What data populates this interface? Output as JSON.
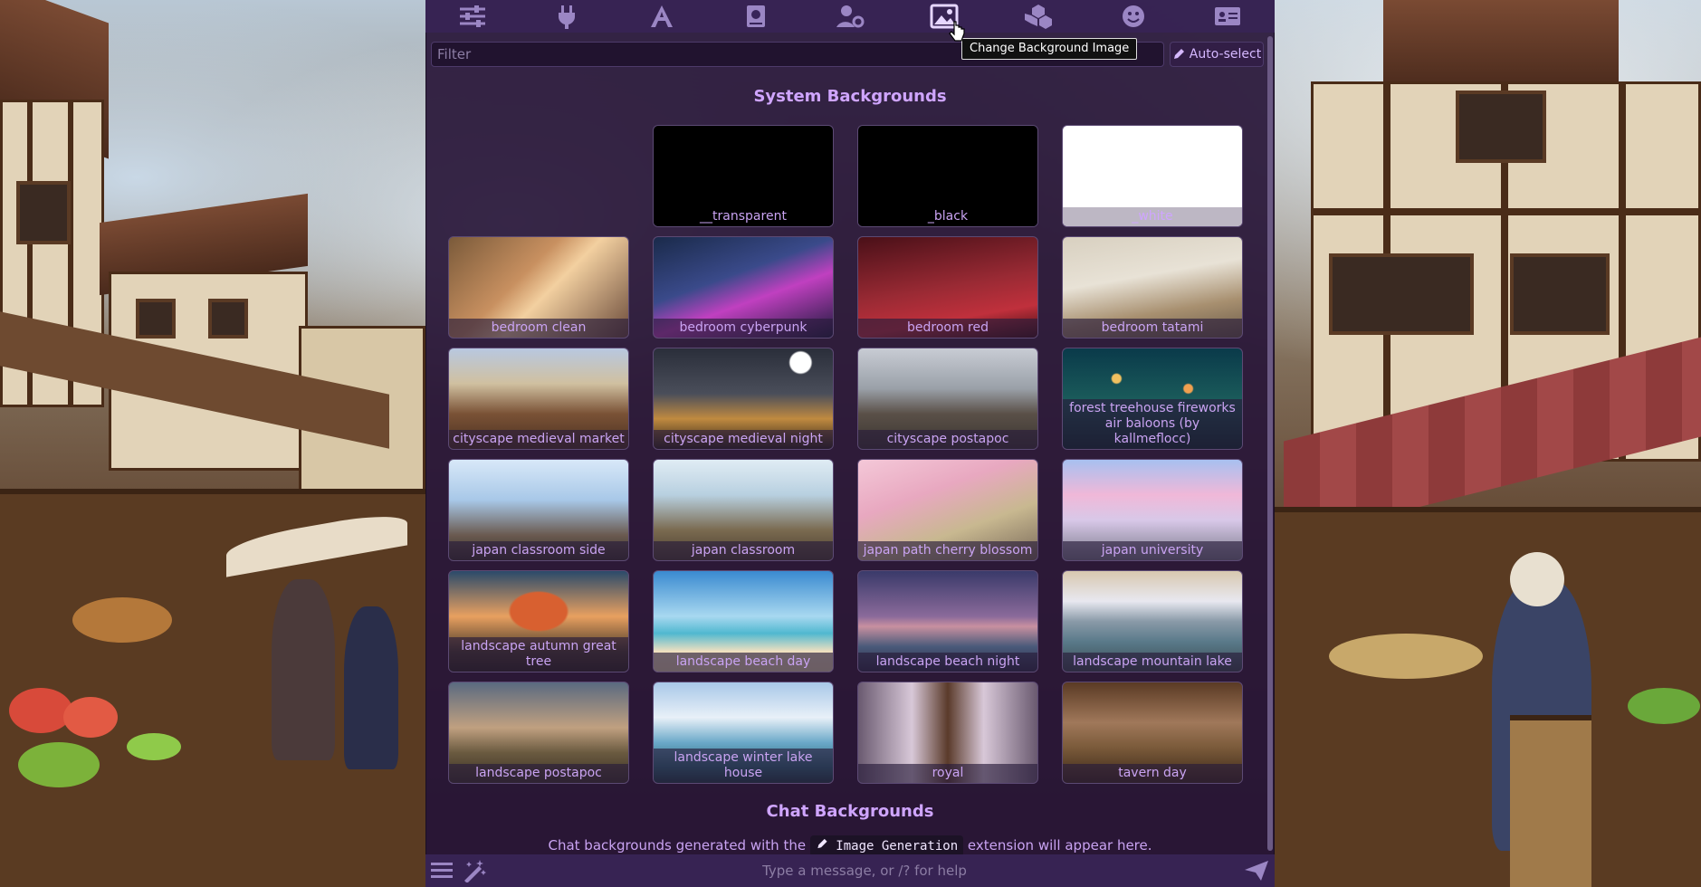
{
  "topbar": {
    "icons": [
      "sliders-icon",
      "plug-icon",
      "font-icon",
      "book-icon",
      "user-gear-icon",
      "image-icon",
      "cubes-icon",
      "smile-icon",
      "id-card-icon"
    ],
    "active_index": 5
  },
  "tooltip": "Change Background Image",
  "filter": {
    "placeholder": "Filter"
  },
  "autoselect_label": "Auto-select",
  "system_heading": "System Backgrounds",
  "backgrounds": [
    {
      "label": "__transparent"
    },
    {
      "label": "_black"
    },
    {
      "label": "_white"
    },
    {
      "label": "bedroom clean"
    },
    {
      "label": "bedroom cyberpunk"
    },
    {
      "label": "bedroom red"
    },
    {
      "label": "bedroom tatami"
    },
    {
      "label": "cityscape medieval market"
    },
    {
      "label": "cityscape medieval night"
    },
    {
      "label": "cityscape postapoc"
    },
    {
      "label": "forest treehouse fireworks air baloons (by kallmeflocc)"
    },
    {
      "label": "japan classroom side"
    },
    {
      "label": "japan classroom"
    },
    {
      "label": "japan path cherry blossom"
    },
    {
      "label": "japan university"
    },
    {
      "label": "landscape autumn great tree"
    },
    {
      "label": "landscape beach day"
    },
    {
      "label": "landscape beach night"
    },
    {
      "label": "landscape mountain lake"
    },
    {
      "label": "landscape postapoc"
    },
    {
      "label": "landscape winter lake house"
    },
    {
      "label": "royal"
    },
    {
      "label": "tavern day"
    }
  ],
  "chat_heading": "Chat Backgrounds",
  "chat_desc": {
    "before": "Chat backgrounds generated with the",
    "code": "Image Generation",
    "after": "extension will appear here."
  },
  "message_placeholder": "Type a message, or /? for help"
}
